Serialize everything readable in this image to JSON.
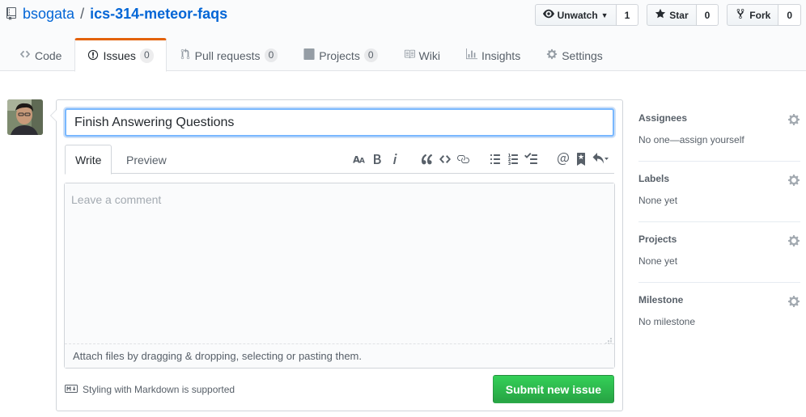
{
  "repo": {
    "owner": "bsogata",
    "separator": "/",
    "name": "ics-314-meteor-faqs"
  },
  "actions": {
    "watch": {
      "label": "Unwatch",
      "count": "1"
    },
    "star": {
      "label": "Star",
      "count": "0"
    },
    "fork": {
      "label": "Fork",
      "count": "0"
    }
  },
  "nav": {
    "code": {
      "label": "Code"
    },
    "issues": {
      "label": "Issues",
      "count": "0"
    },
    "pulls": {
      "label": "Pull requests",
      "count": "0"
    },
    "projects": {
      "label": "Projects",
      "count": "0"
    },
    "wiki": {
      "label": "Wiki"
    },
    "insights": {
      "label": "Insights"
    },
    "settings": {
      "label": "Settings"
    }
  },
  "form": {
    "title_value": "Finish Answering Questions",
    "tabs": {
      "write": "Write",
      "preview": "Preview"
    },
    "comment_placeholder": "Leave a comment",
    "attach_hint": "Attach files by dragging & dropping, selecting or pasting them.",
    "markdown_hint": "Styling with Markdown is supported",
    "submit_label": "Submit new issue"
  },
  "sidebar": {
    "assignees": {
      "heading": "Assignees",
      "value": "No one—assign yourself"
    },
    "labels": {
      "heading": "Labels",
      "value": "None yet"
    },
    "projects": {
      "heading": "Projects",
      "value": "None yet"
    },
    "milestone": {
      "heading": "Milestone",
      "value": "No milestone"
    }
  },
  "colors": {
    "accent_tab": "#e36209",
    "link": "#0366d6",
    "submit": "#28a745",
    "focus_ring": "#79b8ff"
  }
}
